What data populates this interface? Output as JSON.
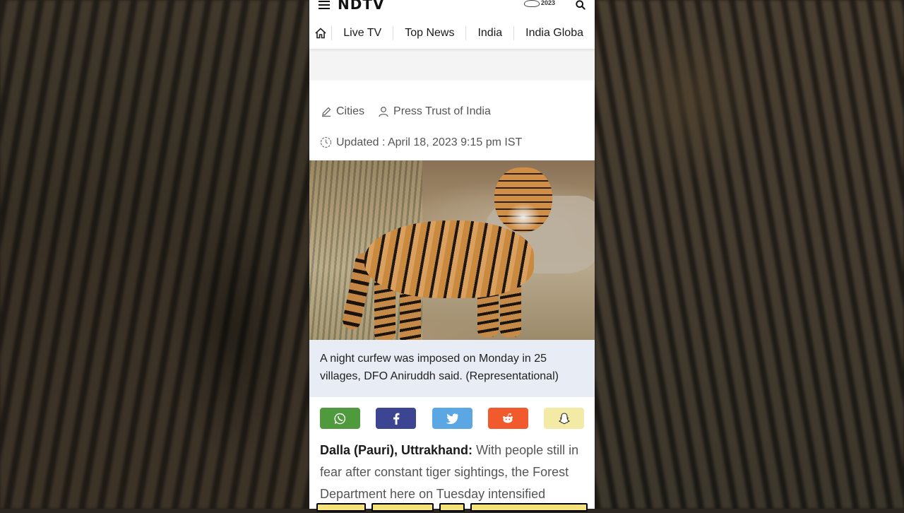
{
  "header": {
    "logo_text": "NDTV",
    "g20_label": "2023"
  },
  "nav": {
    "items": [
      "Live TV",
      "Top News",
      "India",
      "India Globa"
    ]
  },
  "meta": {
    "category": "Cities",
    "author": "Press Trust of India",
    "updated": "Updated : April 18, 2023 9:15 pm IST"
  },
  "caption": "A night curfew was imposed on Monday in 25 villages, DFO Aniruddh said. (Representational)",
  "share": {
    "buttons": [
      {
        "name": "whatsapp",
        "color": "#4f9a3c"
      },
      {
        "name": "facebook",
        "color": "#3b4591"
      },
      {
        "name": "twitter",
        "color": "#5ba7e3"
      },
      {
        "name": "reddit",
        "color": "#f05a2d"
      },
      {
        "name": "snapchat",
        "color": "#f3eaa5"
      }
    ]
  },
  "article": {
    "dateline": "Dalla (Pauri), Uttrakhand:",
    "text": "With people still in fear after constant tiger sightings, the Forest Department here on Tuesday intensified"
  },
  "colors": {
    "brand_red": "#d6001c",
    "caption_bg": "#e8ecf4"
  }
}
